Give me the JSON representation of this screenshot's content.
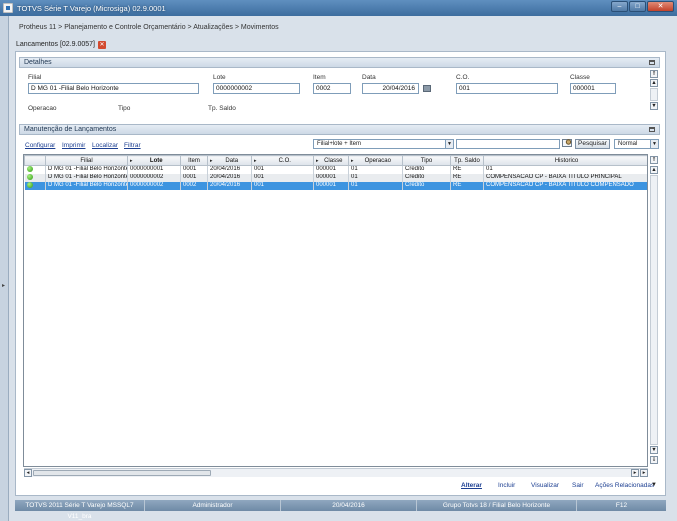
{
  "window": {
    "title": "TOTVS Série T Varejo (Microsiga) 02.9.0001",
    "min": "–",
    "max": "□",
    "close": "✕"
  },
  "breadcrumb": "Protheus 11 > Planejamento e Controle Orçamentário > Atualizações > Movimentos",
  "tab": {
    "label": "Lancamentos [02.9.0057]",
    "close": "✕"
  },
  "detalhes": {
    "header": "Detalhes",
    "labels": {
      "filial": "Filial",
      "lote": "Lote",
      "item": "Item",
      "data": "Data",
      "co": "C.O.",
      "classe": "Classe",
      "operacao": "Operacao",
      "tipo": "Tipo",
      "tp_saldo": "Tp. Saldo"
    },
    "values": {
      "filial": "D MG 01 -Filial Belo Horizonte",
      "lote": "0000000002",
      "item": "0002",
      "data": "20/04/2016",
      "co": "001",
      "classe": "000001"
    }
  },
  "manutencao": {
    "header": "Manutenção de Lançamentos",
    "links": [
      "Configurar",
      "Imprimir",
      "Localizar",
      "Filtrar"
    ],
    "index_select": "Filial+lote + Item",
    "search_value": "",
    "search_button": "Pesquisar",
    "mode_select": "Normal"
  },
  "grid": {
    "columns": [
      "",
      "Filial",
      "Lote",
      "Item",
      "Data",
      "C.O.",
      "Classe",
      "Operacao",
      "Tipo",
      "Tp. Saldo",
      "Historico"
    ],
    "rows": [
      [
        "D MG 01 -Filial Belo Horizonte",
        "0000000001",
        "0001",
        "20/04/2016",
        "001",
        "000001",
        "01",
        "Credito",
        "RE",
        "01"
      ],
      [
        "D MG 01 -Filial Belo Horizonte",
        "0000000002",
        "0001",
        "20/04/2016",
        "001",
        "000001",
        "01",
        "Credito",
        "RE",
        "COMPENSACAO CP - BAIXA TITULO PRINCIPAL"
      ],
      [
        "D MG 01 -Filial Belo Horizonte",
        "0000000002",
        "0002",
        "20/04/2016",
        "001",
        "000001",
        "01",
        "Credito",
        "RE",
        "COMPENSACAO CP - BAIXA TITULO COMPENSADO"
      ]
    ],
    "selected_row": 2
  },
  "actions": {
    "alterar": "Alterar",
    "incluir": "Incluir",
    "visualizar": "Visualizar",
    "sair": "Sair",
    "acoes": "Ações Relacionadas"
  },
  "status": {
    "version": "TOTVS 2011 Série T Varejo MSSQL7 V11_bra",
    "user": "Administrador",
    "date": "20/04/2016",
    "company": "Grupo Totvs 18 / Filial Belo Horizonte",
    "key": "F12"
  }
}
